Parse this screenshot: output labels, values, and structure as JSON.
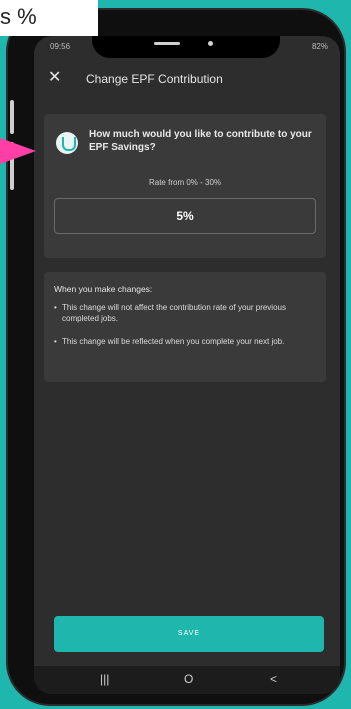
{
  "caption": {
    "text": "s %"
  },
  "arrow": {
    "color": "#ff3fa6"
  },
  "status_bar": {
    "time": "09:56",
    "battery": "82%"
  },
  "app_bar": {
    "close_icon": "close-icon",
    "title": "Change EPF Contribution"
  },
  "contribution_card": {
    "question": "How much would you like to contribute to your EPF Savings?",
    "rate_range": "Rate from 0% - 30%",
    "input_value": "5%"
  },
  "info_card": {
    "heading": "When you make changes:",
    "bullets": [
      "This change will not affect the contribution rate of your previous completed jobs.",
      "This change will be reflected when you complete your next job."
    ]
  },
  "actions": {
    "save_label": "SAVE"
  },
  "android_nav": {
    "recent": "|||",
    "home": "O",
    "back": "<"
  },
  "colors": {
    "accent": "#1fb6ad",
    "screen_bg": "#2d2d2d"
  }
}
